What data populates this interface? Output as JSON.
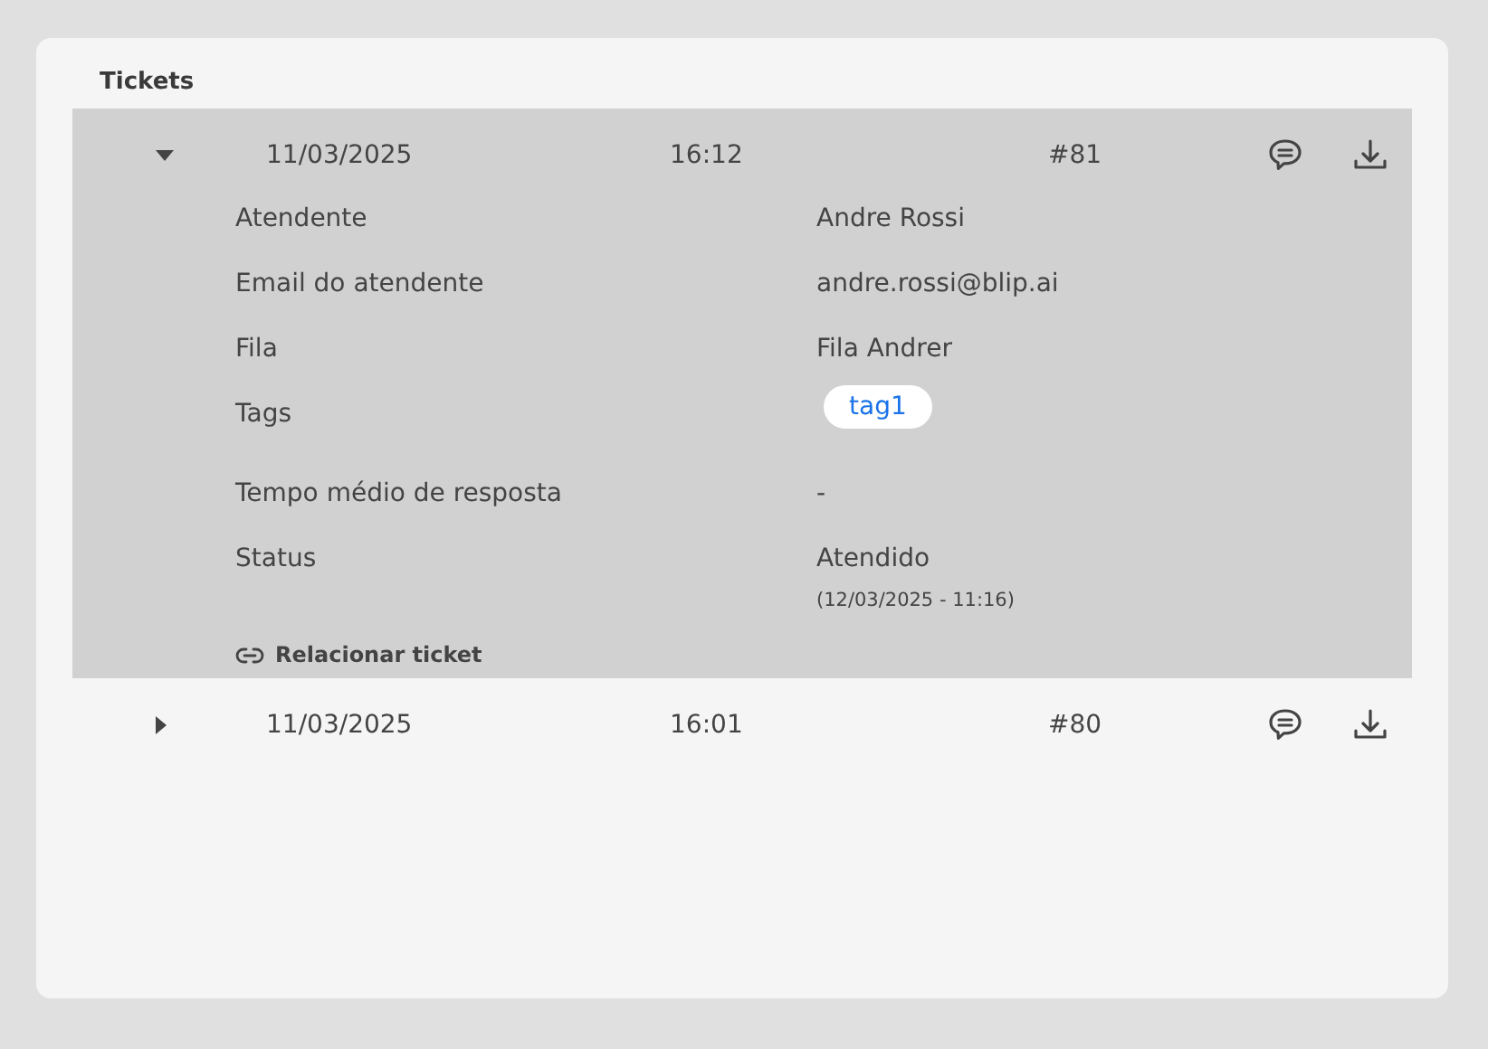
{
  "title": "Tickets",
  "tickets": [
    {
      "expanded": true,
      "date": "11/03/2025",
      "time": "16:12",
      "number": "#81",
      "details": [
        {
          "kind": "text",
          "label": "Atendente",
          "value": "Andre Rossi"
        },
        {
          "kind": "text",
          "label": "Email do atendente",
          "value": "andre.rossi@blip.ai"
        },
        {
          "kind": "text",
          "label": "Fila",
          "value": "Fila Andrer"
        },
        {
          "kind": "tags",
          "label": "Tags",
          "tags": [
            "tag1"
          ]
        },
        {
          "kind": "text",
          "label": "Tempo médio de resposta",
          "value": "-"
        },
        {
          "kind": "status",
          "label": "Status",
          "value": "Atendido",
          "note": "(12/03/2025 - 11:16)"
        }
      ],
      "link": "Relacionar ticket"
    },
    {
      "expanded": false,
      "date": "11/03/2025",
      "time": "16:01",
      "number": "#80"
    }
  ]
}
